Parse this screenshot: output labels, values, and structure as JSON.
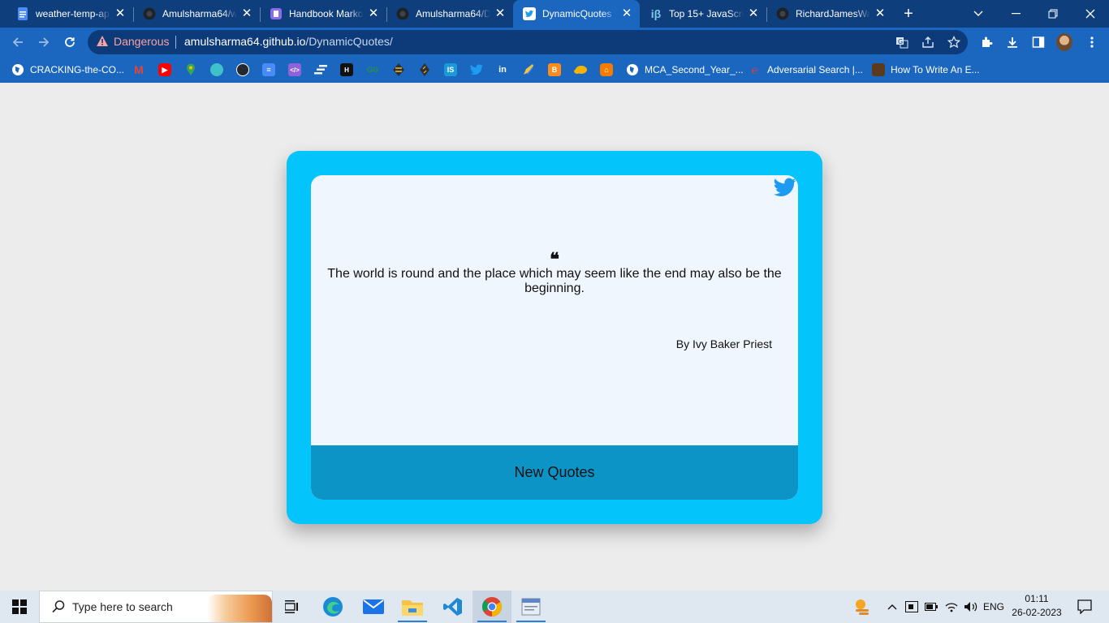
{
  "browser": {
    "tabs": [
      {
        "title": "weather-temp-ap",
        "icon": "docs-icon",
        "color": "#4a8cf7",
        "active": false
      },
      {
        "title": "Amulsharma64/w",
        "icon": "github-icon",
        "color": "#1f2328",
        "active": false
      },
      {
        "title": "Handbook Marko",
        "icon": "handbook-icon",
        "color": "#8b6cf0",
        "active": false
      },
      {
        "title": "Amulsharma64/D",
        "icon": "github-icon",
        "color": "#1f2328",
        "active": false
      },
      {
        "title": "DynamicQuotes",
        "icon": "twitter-icon",
        "color": "#1d9bf0",
        "active": true
      },
      {
        "title": "Top 15+ JavaScri",
        "icon": "ib-icon",
        "color": "#7fc7e8",
        "active": false
      },
      {
        "title": "RichardJamesWa",
        "icon": "github-icon",
        "color": "#1f2328",
        "active": false
      }
    ],
    "omnibox": {
      "security_label": "Dangerous",
      "url_domain": "amulsharma64.github.io",
      "url_path": "/DynamicQuotes/"
    },
    "bookmarks": [
      {
        "label": "CRACKING-the-CO...",
        "icon": "globe-icon",
        "color": "#ffffff"
      },
      {
        "label": "",
        "icon": "gmail-icon",
        "color": "#ea4335"
      },
      {
        "label": "",
        "icon": "youtube-icon",
        "color": "#ff0000"
      },
      {
        "label": "",
        "icon": "maps-icon",
        "color": "#34a853"
      },
      {
        "label": "",
        "icon": "bookmark-icon",
        "color": "#3fc1c9"
      },
      {
        "label": "",
        "icon": "github-icon",
        "color": "#24292f"
      },
      {
        "label": "",
        "icon": "docs-icon",
        "color": "#4a8cf7"
      },
      {
        "label": "",
        "icon": "code-icon",
        "color": "#8e63d9"
      },
      {
        "label": "",
        "icon": "bars-icon",
        "color": "#f2f2f2"
      },
      {
        "label": "",
        "icon": "hackerrank-icon",
        "color": "#111111"
      },
      {
        "label": "",
        "icon": "geeks-icon",
        "color": "#2f8d46"
      },
      {
        "label": "",
        "icon": "diamond-icon",
        "color": "#f7b731"
      },
      {
        "label": "",
        "icon": "diamond-icon",
        "color": "#2f2f2f"
      },
      {
        "label": "",
        "icon": "is-icon",
        "color": "#1a9bd7"
      },
      {
        "label": "",
        "icon": "twitter-icon",
        "color": "#1d9bf0"
      },
      {
        "label": "",
        "icon": "linkedin-icon",
        "color": "#0a66c2"
      },
      {
        "label": "",
        "icon": "pencil-icon",
        "color": "#f4c542"
      },
      {
        "label": "",
        "icon": "blogger-icon",
        "color": "#ff8c1a"
      },
      {
        "label": "",
        "icon": "cloud-icon",
        "color": "#f4b400"
      },
      {
        "label": "",
        "icon": "box-icon",
        "color": "#f57c00"
      },
      {
        "label": "MCA_Second_Year_...",
        "icon": "globe-icon",
        "color": "#ffffff"
      },
      {
        "label": "Adversarial Search |...",
        "icon": "e-icon",
        "color": "#e53935"
      },
      {
        "label": "How To Write An E...",
        "icon": "scroll-icon",
        "color": "#5b3a1e"
      }
    ]
  },
  "quote_app": {
    "quote_mark": "❝",
    "quote_text": "The world is round and the place which may seem like the end may also be the beginning.",
    "author": "By Ivy Baker Priest",
    "new_quote_label": "New Quotes",
    "colors": {
      "outer": "#03c4fb",
      "inner": "#f0f6fe",
      "button": "#0c94c6",
      "twitter": "#1d9bf0"
    }
  },
  "taskbar": {
    "search_placeholder": "Type here to search",
    "language": "ENG",
    "time": "01:11",
    "date": "26-02-2023"
  }
}
